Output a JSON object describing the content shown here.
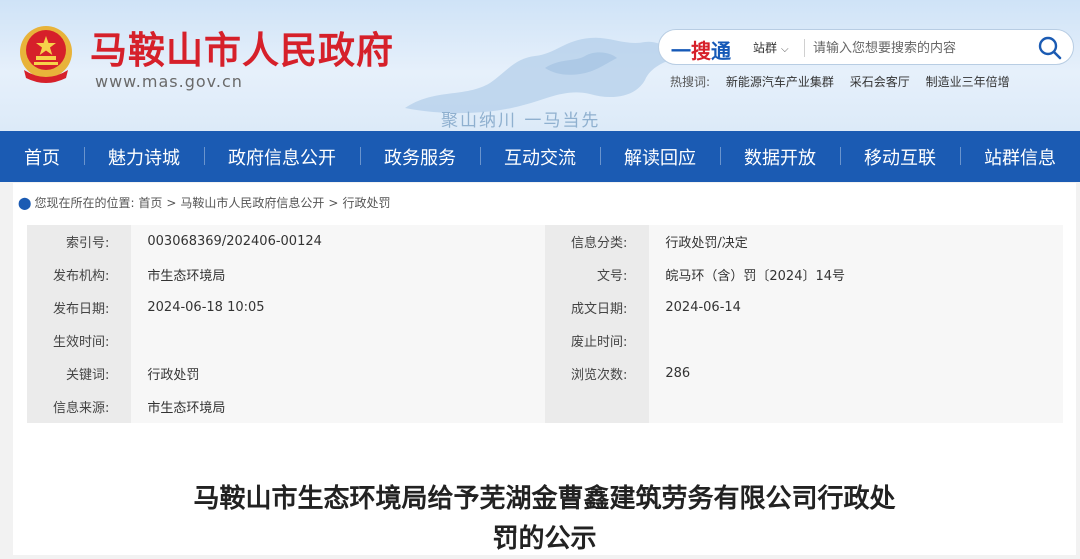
{
  "header": {
    "site_name": "马鞍山市人民政府",
    "site_url": "www.mas.gov.cn",
    "slogan": "聚山纳川  一马当先",
    "emblem_icon": "national-emblem-icon",
    "colors": {
      "brand_red": "#d6202a",
      "brand_blue": "#1b5bb3"
    }
  },
  "search": {
    "brand_a": "一",
    "brand_b": "搜",
    "brand_c": "通",
    "scope": "站群",
    "placeholder": "请输入您想要搜索的内容",
    "hot_label": "热搜词:",
    "hot_words": [
      "新能源汽车产业集群",
      "采石会客厅",
      "制造业三年倍增"
    ]
  },
  "nav": {
    "items": [
      "首页",
      "魅力诗城",
      "政府信息公开",
      "政务服务",
      "互动交流",
      "解读回应",
      "数据开放",
      "移动互联",
      "站群信息"
    ]
  },
  "breadcrumb": {
    "prefix": "您现在所在的位置:",
    "items": [
      "首页",
      "马鞍山市人民政府信息公开",
      "行政处罚"
    ],
    "separator": ">"
  },
  "meta": {
    "rows": [
      {
        "l1": "索引号:",
        "v1": "003068369/202406-00124",
        "l2": "信息分类:",
        "v2": "行政处罚/决定"
      },
      {
        "l1": "发布机构:",
        "v1": "市生态环境局",
        "l2": "文号:",
        "v2": "皖马环（含）罚〔2024〕14号"
      },
      {
        "l1": "发布日期:",
        "v1": "2024-06-18  10:05",
        "l2": "成文日期:",
        "v2": "2024-06-14"
      },
      {
        "l1": "生效时间:",
        "v1": "",
        "l2": "废止时间:",
        "v2": ""
      },
      {
        "l1": "关键词:",
        "v1": "行政处罚",
        "l2": "浏览次数:",
        "v2": "286"
      },
      {
        "l1": "信息来源:",
        "v1": "市生态环境局",
        "l2": "",
        "v2": ""
      }
    ]
  },
  "article": {
    "title_line1": "马鞍山市生态环境局给予芜湖金曹鑫建筑劳务有限公司行政处",
    "title_line2": "罚的公示"
  }
}
